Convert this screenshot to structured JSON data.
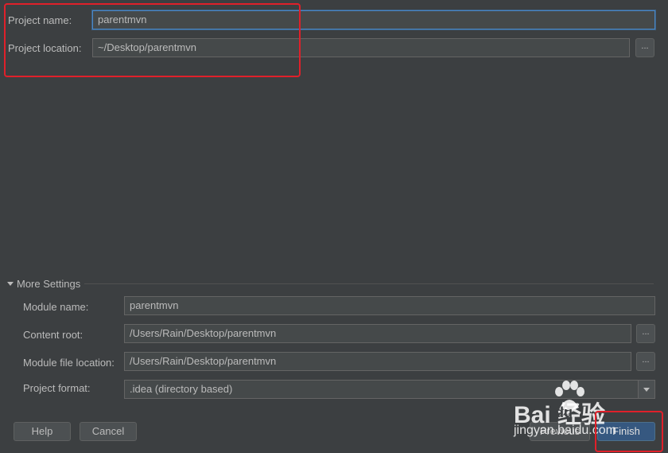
{
  "project": {
    "name_label": "Project name:",
    "name_value": "parentmvn",
    "location_label": "Project location:",
    "location_value": "~/Desktop/parentmvn"
  },
  "more_settings": {
    "header": "More Settings",
    "module_name_label": "Module name:",
    "module_name_value": "parentmvn",
    "content_root_label": "Content root:",
    "content_root_value": "/Users/Rain/Desktop/parentmvn",
    "module_file_label": "Module file location:",
    "module_file_value": "/Users/Rain/Desktop/parentmvn",
    "format_label": "Project format:",
    "format_value": ".idea (directory based)"
  },
  "browse_label": "...",
  "buttons": {
    "help": "Help",
    "cancel": "Cancel",
    "previous": "Previous",
    "finish": "Finish"
  },
  "watermark": {
    "brand": "Bai  经验",
    "brand_mid": "du",
    "url": "jingyan.baidu.com"
  },
  "colors": {
    "background": "#3c3f41",
    "field_bg": "#45494a",
    "focus_border": "#4a88c7",
    "primary_button": "#365880",
    "annotation_red": "#e0202a"
  }
}
